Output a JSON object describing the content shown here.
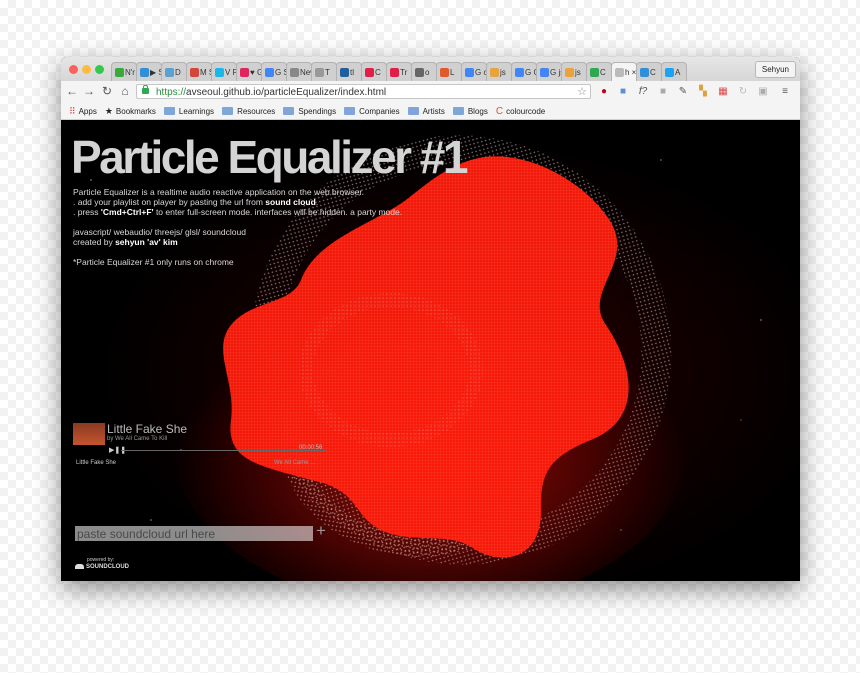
{
  "window": {
    "profile_name": "Sehyun",
    "tabs": [
      {
        "label": "N'r",
        "color": "#3aa83a"
      },
      {
        "label": "▶ S",
        "color": "#2f8fd8"
      },
      {
        "label": "D",
        "color": "#5aa0d0"
      },
      {
        "label": "M S",
        "color": "#d44638"
      },
      {
        "label": "V P",
        "color": "#1ab7ea"
      },
      {
        "label": "♥ G",
        "color": "#e0245e"
      },
      {
        "label": "G S",
        "color": "#4285f4"
      },
      {
        "label": "New",
        "color": "#888888"
      },
      {
        "label": "T",
        "color": "#999999"
      },
      {
        "label": "tl",
        "color": "#1f5fa0"
      },
      {
        "label": "C",
        "color": "#e11d48"
      },
      {
        "label": "Tr",
        "color": "#e11d48"
      },
      {
        "label": "o",
        "color": "#666666"
      },
      {
        "label": "L",
        "color": "#e05a2b"
      },
      {
        "label": "G c",
        "color": "#4285f4"
      },
      {
        "label": "js",
        "color": "#e8a33d"
      },
      {
        "label": "G C",
        "color": "#4285f4"
      },
      {
        "label": "G js",
        "color": "#4285f4"
      },
      {
        "label": "js",
        "color": "#e8a33d"
      },
      {
        "label": "C",
        "color": "#2fa84f"
      },
      {
        "label": "h ×",
        "color": "#bbbbbb",
        "active": true
      },
      {
        "label": "C",
        "color": "#2f8fd8"
      },
      {
        "label": "A",
        "color": "#1da1f2"
      }
    ]
  },
  "toolbar": {
    "url_scheme": "https://",
    "url_rest": "avseoul.github.io/particleEqualizer/index.html"
  },
  "bookmarks": {
    "apps": "Apps",
    "bookmarks": "Bookmarks",
    "items": [
      "Learnings",
      "Resources",
      "Spendings",
      "Companies",
      "Artists",
      "Blogs",
      "colourcode"
    ]
  },
  "page": {
    "title": "Particle Equalizer #1",
    "desc1": "Particle Equalizer is a realtime audio reactive application on the web browser.",
    "desc2_pre": ". add your playlist on player by pasting the url from ",
    "desc2_bold": "sound cloud",
    "desc2_post": ".",
    "desc3_pre": ". press ",
    "desc3_bold": "'Cmd+Ctrl+F'",
    "desc3_post": " to enter full-screen mode. interfaces will be hidden. a party mode.",
    "tech": "javascript/ webaudio/ threejs/ glsl/ soundcloud",
    "created_pre": "created by ",
    "created_name": "sehyun 'av' kim",
    "note": "*Particle Equalizer #1 only runs on chrome"
  },
  "player": {
    "track_title": "Little Fake She",
    "artist": "by We All Came To Kill",
    "controls": "▶❚❚",
    "time": "00:00:56",
    "playlist_left": "Little Fake She",
    "playlist_right": "We All Came ..."
  },
  "input": {
    "placeholder": "paste soundcloud url here",
    "add": "+"
  },
  "footer": {
    "powered": "powered by:",
    "soundcloud": "SOUNDCLOUD"
  },
  "colors": {
    "accent_red": "#ff1a0a",
    "ring_color": "#e8c8c0"
  }
}
